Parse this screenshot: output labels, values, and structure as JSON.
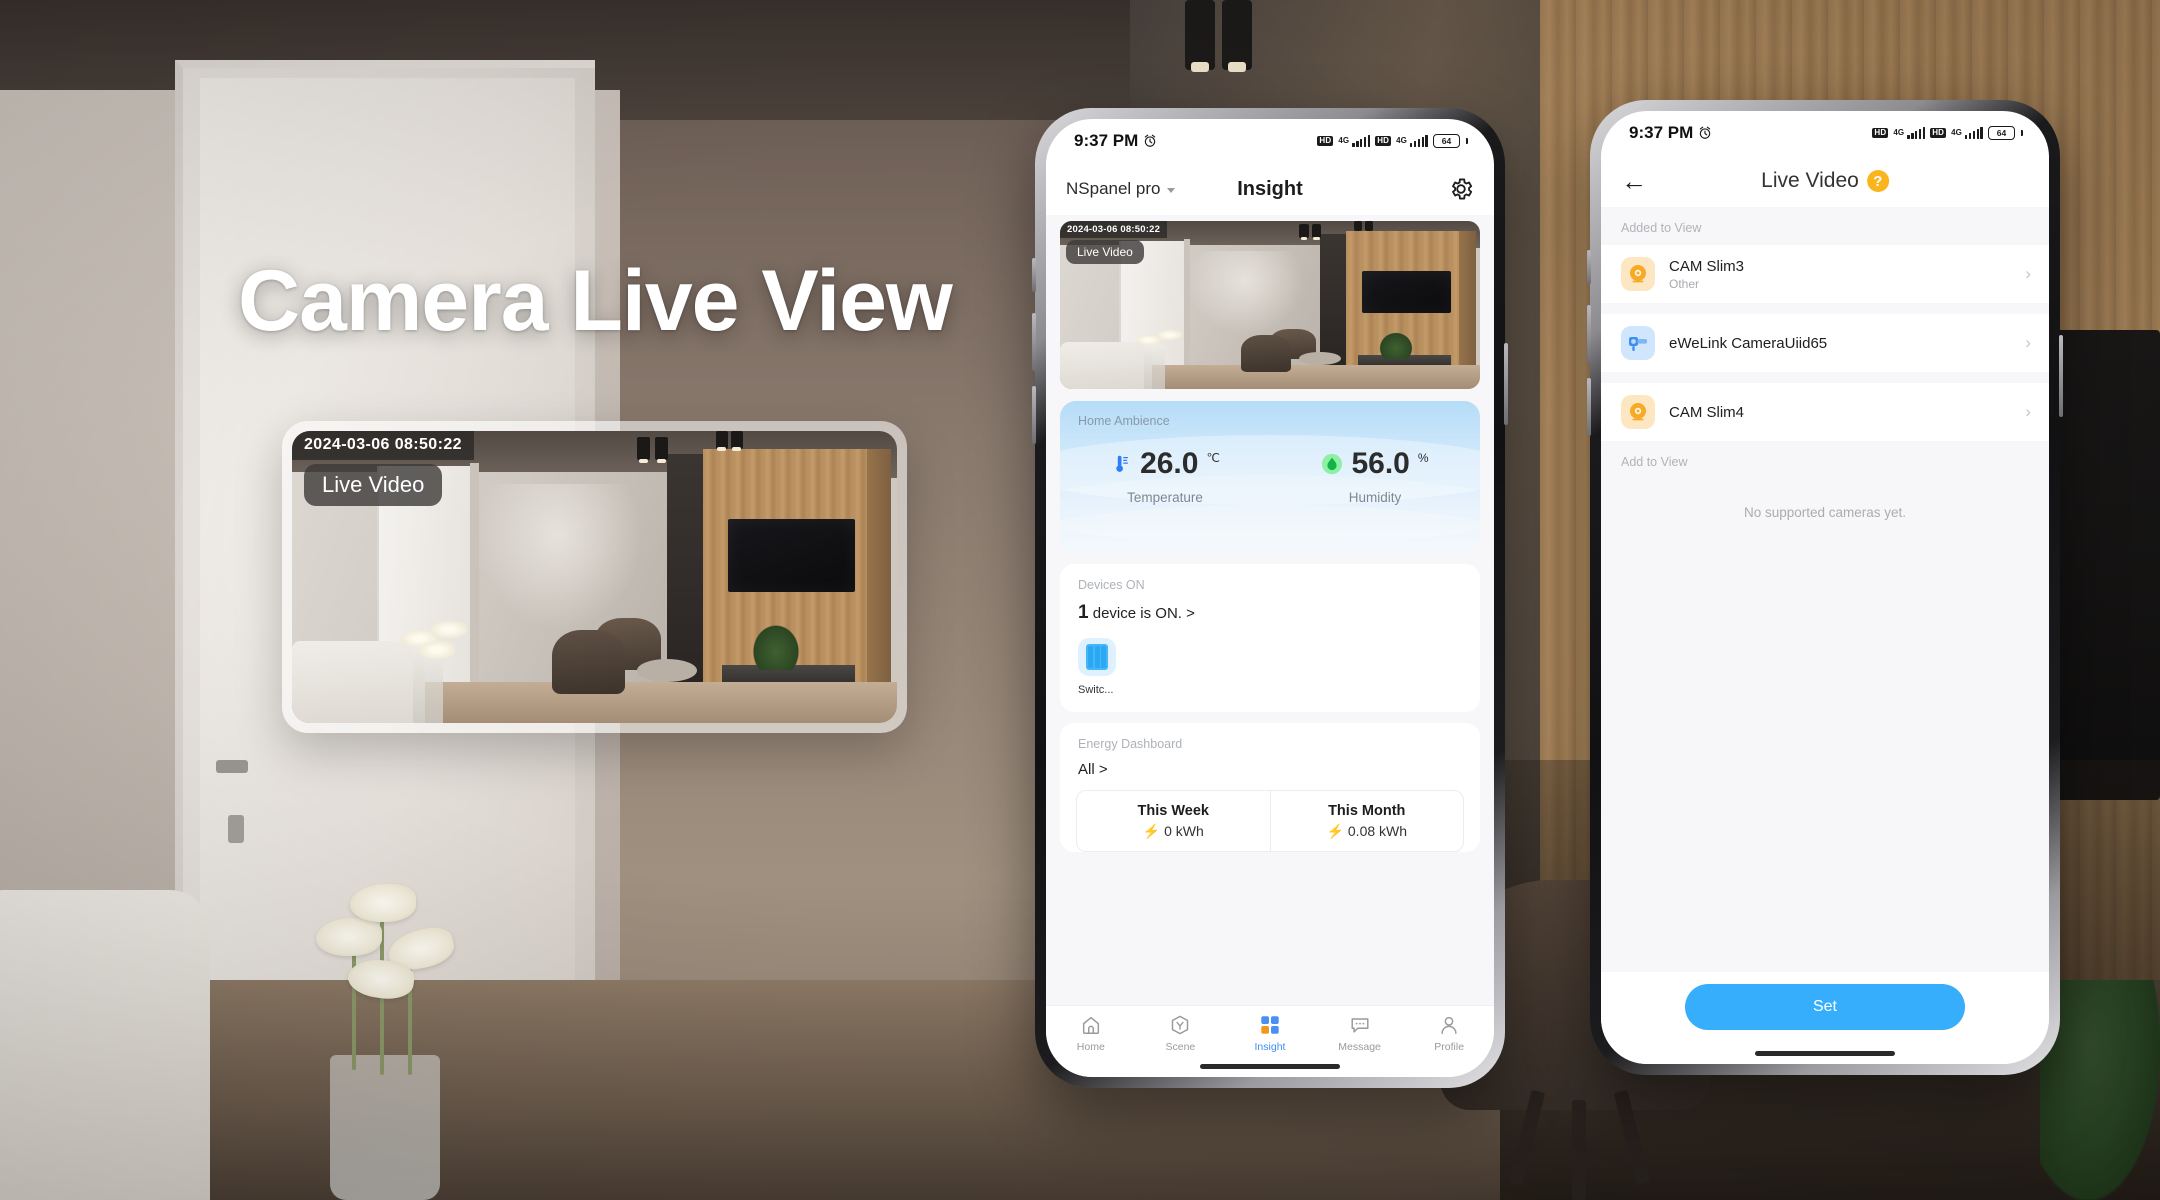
{
  "hero": {
    "title": "Camera Live View",
    "card": {
      "timestamp": "2024-03-06  08:50:22",
      "badge": "Live Video"
    }
  },
  "phone1": {
    "status_bar": {
      "time": "9:37 PM",
      "alarm_icon": "alarm-clock-icon",
      "hd_label": "HD",
      "network_label": "4G",
      "battery_level": "64"
    },
    "navbar": {
      "home_name": "NSpanel pro",
      "dropdown_icon": "chevron-down-icon",
      "title": "Insight",
      "settings_icon": "gear-icon"
    },
    "video_card": {
      "timestamp": "2024-03-06  08:50:22",
      "badge": "Live Video"
    },
    "ambience": {
      "label": "Home Ambience",
      "temperature": {
        "value": "26.0",
        "unit": "℃",
        "caption": "Temperature",
        "icon": "thermometer-icon"
      },
      "humidity": {
        "value": "56.0",
        "unit": "%",
        "caption": "Humidity",
        "icon": "humidity-drop-icon"
      }
    },
    "devices_on": {
      "label": "Devices ON",
      "count": "1",
      "summary_rest": " device is ON. >",
      "device_name": "Switc...",
      "device_icon": "wall-switch-icon"
    },
    "energy": {
      "label": "Energy Dashboard",
      "filter": "All >",
      "items": [
        {
          "title": "This Week",
          "value": "0 kWh",
          "bolt": "⚡",
          "bolt_color": "#2f7cf6"
        },
        {
          "title": "This Month",
          "value": "0.08 kWh",
          "bolt": "⚡",
          "bolt_color": "#f9b118"
        }
      ]
    },
    "tabs": [
      {
        "label": "Home",
        "icon": "home-icon",
        "active": false
      },
      {
        "label": "Scene",
        "icon": "scene-hexagon-icon",
        "active": false
      },
      {
        "label": "Insight",
        "icon": "insight-grid-icon",
        "active": true
      },
      {
        "label": "Message",
        "icon": "message-bubble-icon",
        "active": false
      },
      {
        "label": "Profile",
        "icon": "profile-person-icon",
        "active": false
      }
    ],
    "accent_color": "#3f8ef7"
  },
  "phone2": {
    "status_bar": {
      "time": "9:37 PM",
      "alarm_icon": "alarm-clock-icon",
      "hd_label": "HD",
      "network_label": "4G",
      "battery_level": "64"
    },
    "navbar": {
      "back_icon": "back-arrow-icon",
      "title": "Live Video",
      "help_icon": "help-question-icon",
      "help_color": "#fcb41c"
    },
    "added_section": {
      "label": "Added to View",
      "cameras": [
        {
          "name": "CAM Slim3",
          "sub": "Other",
          "icon": "camera-dome-icon",
          "icon_style": "orange",
          "chevron": "›"
        },
        {
          "name": "eWeLink CameraUiid65",
          "sub": "",
          "icon": "camera-bullet-icon",
          "icon_style": "blue",
          "chevron": "›"
        },
        {
          "name": "CAM Slim4",
          "sub": "",
          "icon": "camera-dome-icon",
          "icon_style": "orange",
          "chevron": "›"
        }
      ]
    },
    "add_section": {
      "label": "Add to View",
      "empty_message": "No supported cameras yet."
    },
    "set_button": {
      "label": "Set",
      "color": "#36aefb"
    }
  }
}
